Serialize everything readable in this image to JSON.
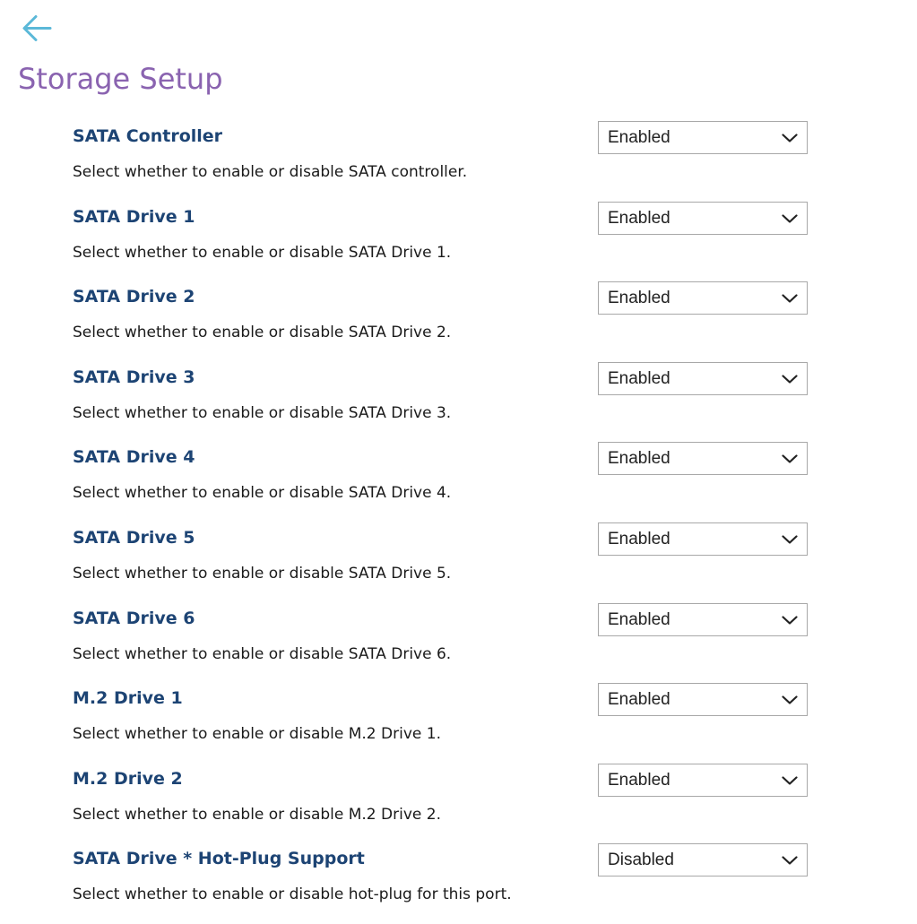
{
  "header": {
    "back_icon": "arrow-left-icon",
    "title": "Storage Setup"
  },
  "colors": {
    "back_arrow": "#5bb8d8",
    "title": "#8a63b0",
    "label": "#1d4474",
    "description": "#1a1a1a"
  },
  "settings": [
    {
      "label": "SATA Controller",
      "description": "Select whether to enable or disable SATA controller.",
      "value": "Enabled"
    },
    {
      "label": "SATA Drive 1",
      "description": "Select whether to enable or disable SATA Drive 1.",
      "value": "Enabled"
    },
    {
      "label": "SATA Drive 2",
      "description": "Select whether to enable or disable SATA Drive 2.",
      "value": "Enabled"
    },
    {
      "label": "SATA Drive 3",
      "description": "Select whether to enable or disable SATA Drive 3.",
      "value": "Enabled"
    },
    {
      "label": "SATA Drive 4",
      "description": "Select whether to enable or disable SATA Drive 4.",
      "value": "Enabled"
    },
    {
      "label": "SATA Drive 5",
      "description": "Select whether to enable or disable SATA Drive 5.",
      "value": "Enabled"
    },
    {
      "label": "SATA Drive 6",
      "description": "Select whether to enable or disable SATA Drive 6.",
      "value": "Enabled"
    },
    {
      "label": "M.2 Drive 1",
      "description": "Select whether to enable or disable M.2 Drive 1.",
      "value": "Enabled"
    },
    {
      "label": "M.2 Drive 2",
      "description": "Select whether to enable or disable M.2 Drive 2.",
      "value": "Enabled"
    },
    {
      "label": "SATA Drive * Hot-Plug Support",
      "description": "Select whether to enable or disable hot-plug for this port.",
      "value": "Disabled"
    }
  ]
}
